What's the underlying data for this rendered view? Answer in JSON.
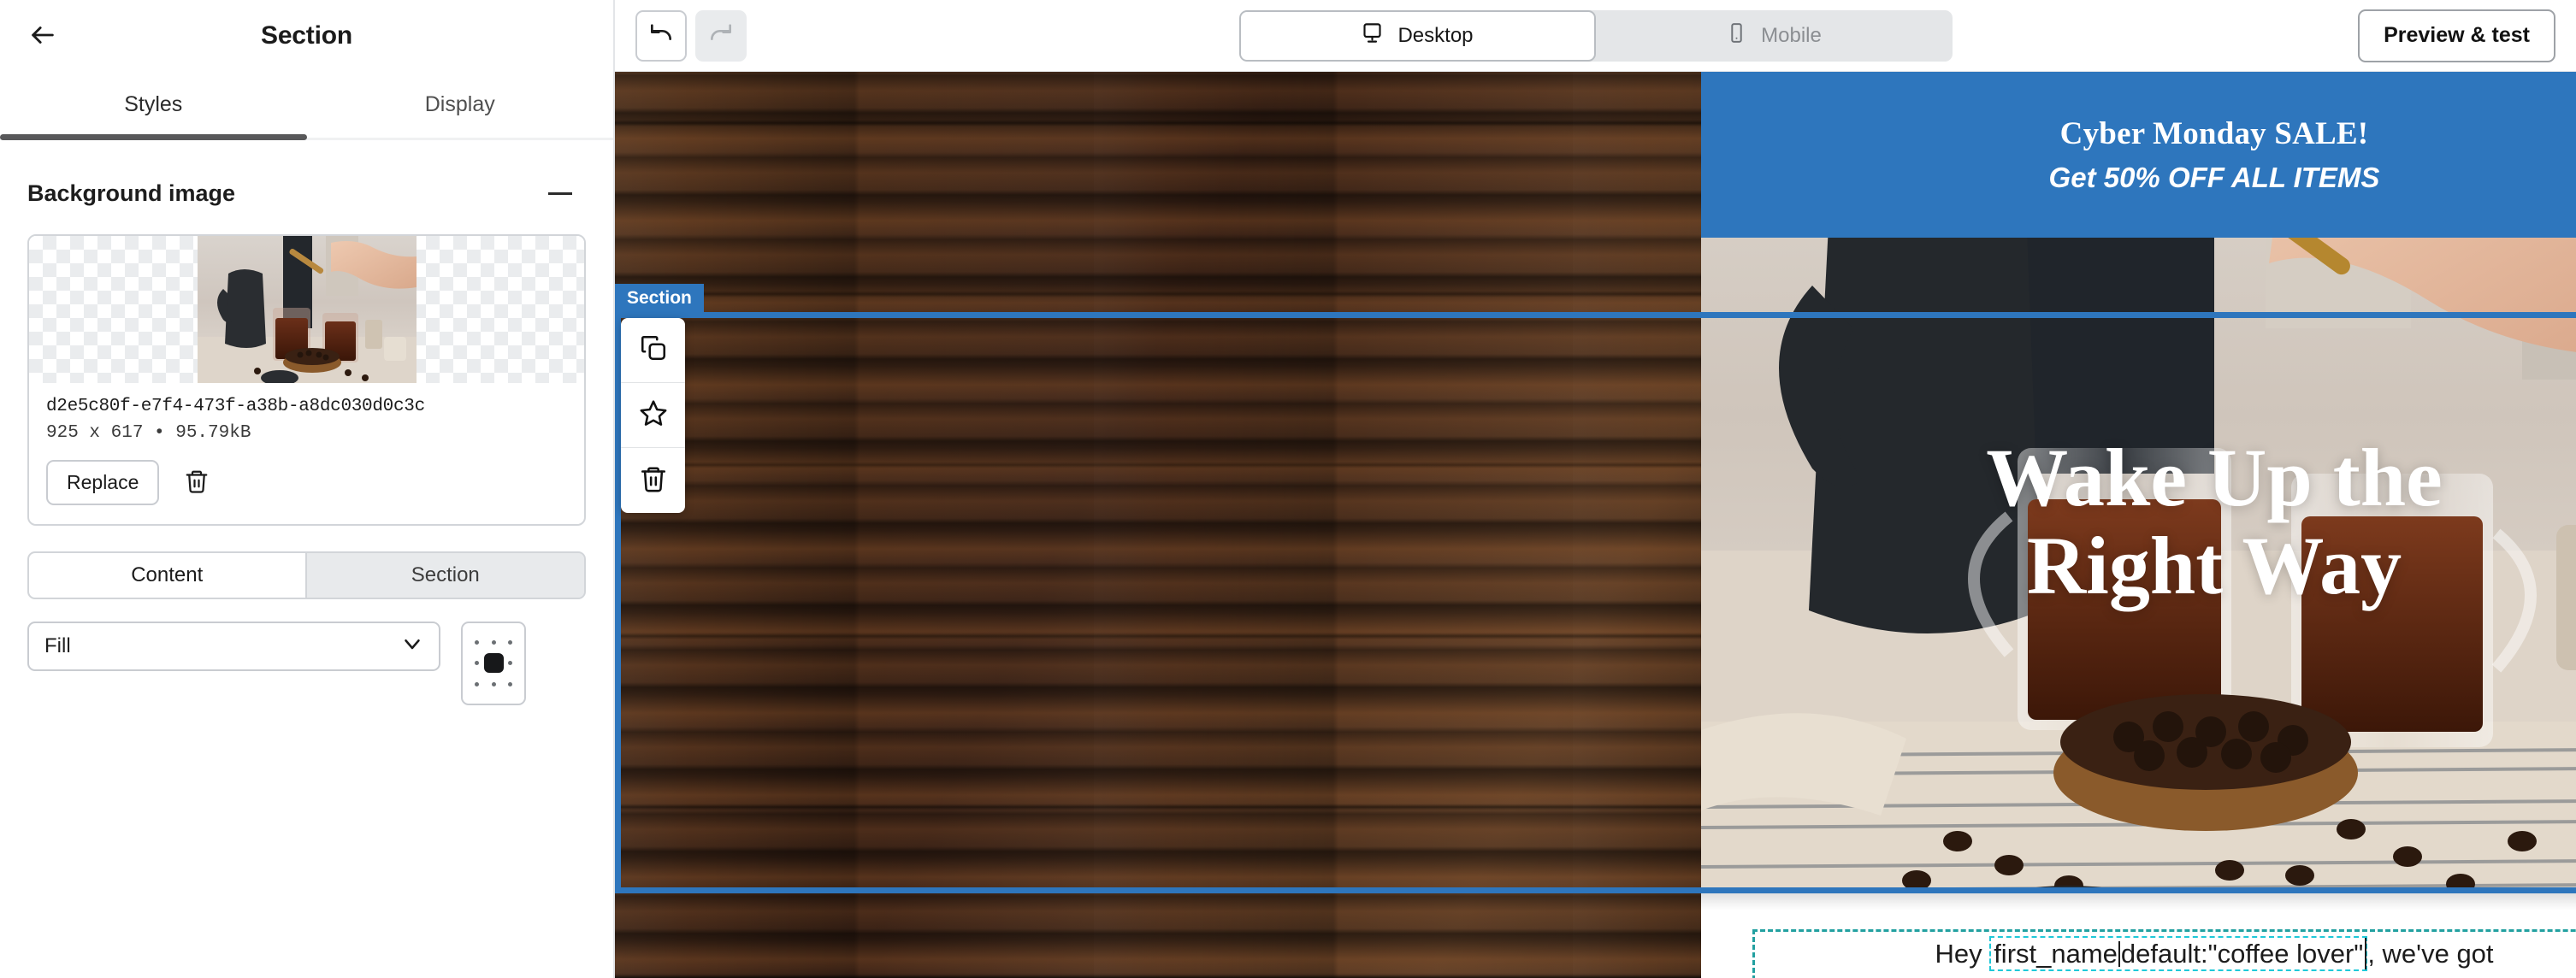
{
  "sidebar": {
    "back_icon": "arrow-left-icon",
    "title": "Section",
    "tabs": [
      {
        "label": "Styles",
        "active": true
      },
      {
        "label": "Display",
        "active": false
      }
    ],
    "background_image_panel": {
      "heading": "Background image",
      "collapse_icon": "minus-icon",
      "file_name": "d2e5c80f-e7f4-473f-a38b-a8dc030d0c3c",
      "file_meta": "925 x 617 • 95.79kB",
      "replace_label": "Replace",
      "delete_icon": "trash-icon"
    },
    "scope_toggle": [
      {
        "label": "Content",
        "active": true
      },
      {
        "label": "Section",
        "active": false
      }
    ],
    "size_select": {
      "value": "Fill",
      "chevron_icon": "chevron-down-icon"
    },
    "position_grid": {
      "name": "background-position-grid",
      "selected": "center"
    }
  },
  "toolbar": {
    "undo": {
      "icon": "undo-icon",
      "enabled": true
    },
    "redo": {
      "icon": "redo-icon",
      "enabled": false
    },
    "devices": [
      {
        "label": "Desktop",
        "icon": "desktop-icon",
        "active": true
      },
      {
        "label": "Mobile",
        "icon": "mobile-icon",
        "active": false
      }
    ],
    "preview_label": "Preview & test"
  },
  "canvas": {
    "selection_badge": "Section",
    "float_tools": [
      {
        "name": "duplicate-icon"
      },
      {
        "name": "star-icon"
      },
      {
        "name": "trash-icon"
      }
    ],
    "promo": {
      "line1": "Cyber Monday SALE!",
      "line2": "Get 50% OFF ALL ITEMS",
      "background_color": "#2e76bd",
      "text_color": "#ffffff"
    },
    "hero": {
      "heading_line1": "Wake Up the",
      "heading_line2": "Right Way",
      "text_color": "#ffffff"
    },
    "body_text": {
      "prefix": "Hey ",
      "merge_tag_part1": "first_name",
      "merge_tag_part2": "default:\"coffee lover\"",
      "suffix": ", we've got"
    }
  },
  "colors": {
    "brand_blue": "#2e76bd",
    "selection_teal": "#22a0a0",
    "merge_tag_cyan": "#1fc8d8",
    "tab_underline": "#58585a"
  }
}
